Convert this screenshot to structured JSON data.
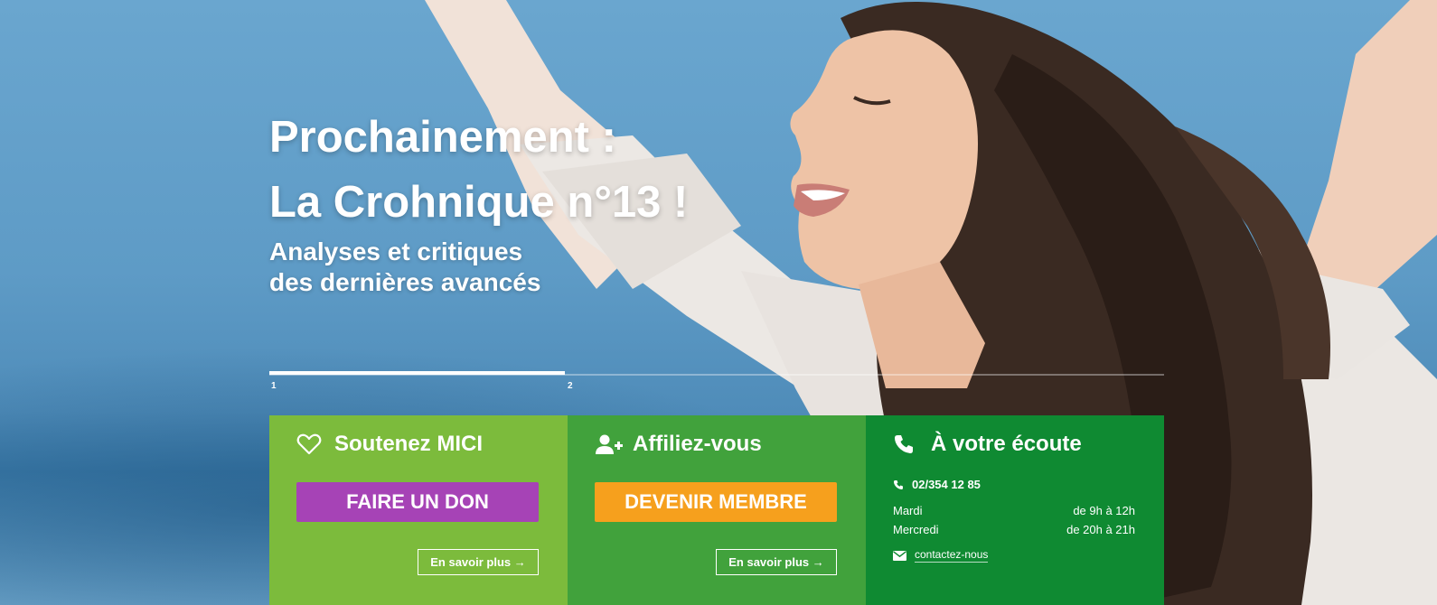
{
  "hero": {
    "headline_line1": "Prochainement :",
    "headline_line2": "La Crohnique n°13 !",
    "subline_line1": "Analyses et critiques",
    "subline_line2": "des dernières avancés",
    "slider": {
      "slides": [
        "1",
        "2"
      ],
      "active": 1,
      "progress": 0.33
    }
  },
  "boxes": {
    "support": {
      "icon": "heart-icon",
      "title": "Soutenez MICI",
      "cta": "FAIRE UN DON",
      "cta_color": "#a643b6",
      "more": "En savoir plus →",
      "bg": "#7cbb3c"
    },
    "join": {
      "icon": "user-plus-icon",
      "title": "Affiliez-vous",
      "cta": "DEVENIR MEMBRE",
      "cta_color": "#f6a01d",
      "more": "En savoir plus →",
      "bg": "#41a23c"
    },
    "listen": {
      "icon": "phone-icon",
      "title": "À votre écoute",
      "phone": "02/354 12 85",
      "hours": [
        {
          "day": "Mardi",
          "time": "de 9h à 12h"
        },
        {
          "day": "Mercredi",
          "time": "de 20h à 21h"
        }
      ],
      "contact_label": "contactez-nous",
      "bg": "#0f8a32"
    }
  }
}
